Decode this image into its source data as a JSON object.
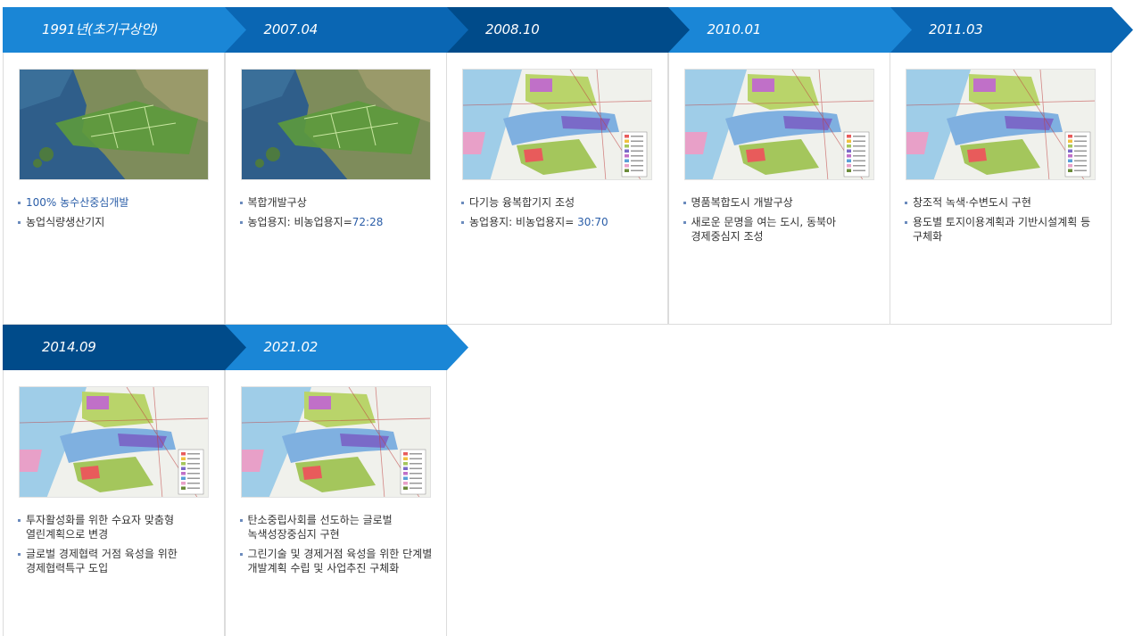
{
  "colors": {
    "accent_dark": "#004b8a",
    "accent_mid": "#0a66b3",
    "accent_light": "#1a86d6",
    "highlight_text": "#2b5ea8"
  },
  "timeline": [
    {
      "date": "1991년(초기구상안)",
      "tone": "light",
      "image": "satellite-map",
      "items": [
        {
          "text": "100% 농수산중심개발",
          "highlight": true
        },
        {
          "text": "농업식량생산기지"
        }
      ]
    },
    {
      "date": "2007.04",
      "tone": "mid",
      "image": "satellite-map",
      "items": [
        {
          "text": "복합개발구상"
        },
        {
          "text": "농업용지: 비농업용지=",
          "suffix": "72:28"
        }
      ]
    },
    {
      "date": "2008.10",
      "tone": "dark",
      "image": "land-use-map",
      "items": [
        {
          "text": "다기능 융복합기지 조성"
        },
        {
          "text": "농업용지: 비농업용지= ",
          "suffix": "30:70"
        }
      ]
    },
    {
      "date": "2010.01",
      "tone": "light",
      "image": "land-use-map",
      "items": [
        {
          "text": "명품복합도시 개발구상"
        },
        {
          "text": "새로운 문명을 여는 도시, 동북아 경제중심지 조성"
        }
      ]
    },
    {
      "date": "2011.03",
      "tone": "mid",
      "image": "land-use-map",
      "items": [
        {
          "text": "창조적 녹색·수변도시 구현"
        },
        {
          "text": "용도별 토지이용계획과 기반시설계획 등 구체화"
        }
      ]
    },
    {
      "date": "2014.09",
      "tone": "dark",
      "image": "land-use-map",
      "items": [
        {
          "text": "투자활성화를 위한 수요자 맞춤형 열린계획으로 변경"
        },
        {
          "text": "글로벌 경제협력 거점 육성을 위한 경제협력특구 도입"
        }
      ]
    },
    {
      "date": "2021.02",
      "tone": "light",
      "image": "land-use-map",
      "items": [
        {
          "text": "탄소중립사회를 선도하는 글로벌 녹색성장중심지 구현"
        },
        {
          "text": "그린기술 및 경제거점 육성을 위한 단계별 개발계획 수립 및 사업추진 구체화"
        }
      ]
    }
  ]
}
